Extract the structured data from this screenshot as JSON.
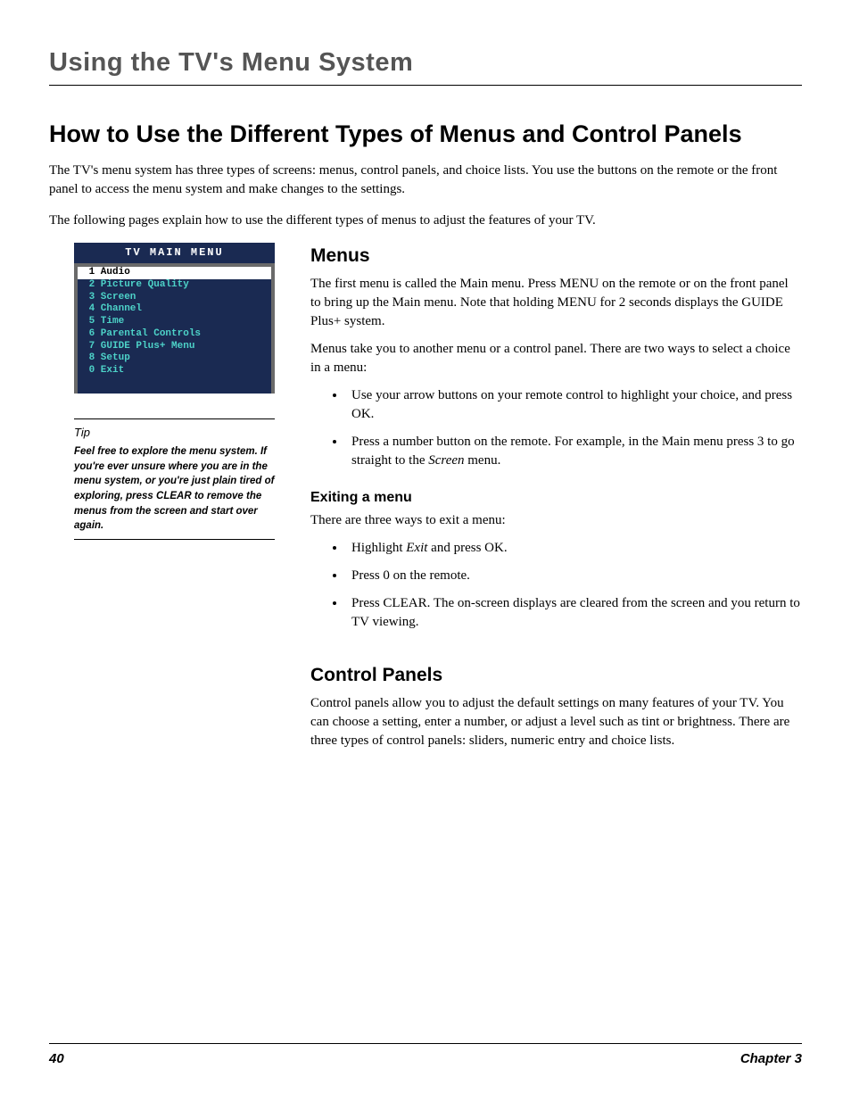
{
  "chapterTitle": "Using the TV's Menu System",
  "sectionTitle": "How to Use the Different Types of Menus and Control Panels",
  "intro": {
    "p1": "The TV's menu system has three types of screens: menus, control panels, and choice lists. You use the buttons on the remote or the front panel to access the menu system and make changes to the settings.",
    "p2": "The following pages explain how to use the different types of menus to adjust the features of your TV."
  },
  "tvMenu": {
    "title": "TV MAIN MENU",
    "items": [
      {
        "num": "1",
        "label": "Audio",
        "selected": true
      },
      {
        "num": "2",
        "label": "Picture Quality",
        "selected": false
      },
      {
        "num": "3",
        "label": "Screen",
        "selected": false
      },
      {
        "num": "4",
        "label": "Channel",
        "selected": false
      },
      {
        "num": "5",
        "label": "Time",
        "selected": false
      },
      {
        "num": "6",
        "label": "Parental Controls",
        "selected": false
      },
      {
        "num": "7",
        "label": "GUIDE Plus+ Menu",
        "selected": false
      },
      {
        "num": "8",
        "label": "Setup",
        "selected": false
      },
      {
        "num": "0",
        "label": "Exit",
        "selected": false
      }
    ]
  },
  "tip": {
    "label": "Tip",
    "text": "Feel free to explore the menu system. If you're ever unsure where you are in the menu system, or you're just plain tired of exploring, press CLEAR to remove the menus from the screen and start over again."
  },
  "menus": {
    "heading": "Menus",
    "p1": "The first menu is called the Main menu. Press MENU on the remote or on the front panel to bring up the Main menu. Note that holding MENU for 2 seconds displays the GUIDE Plus+ system.",
    "p2": "Menus take you to another menu or a control panel. There are two ways to select a choice in a menu:",
    "b1": "Use your arrow buttons on your remote control to highlight your choice, and press OK.",
    "b2a": "Press a number button on the remote. For example, in the Main menu press 3 to go straight to the ",
    "b2em": "Screen",
    "b2b": " menu."
  },
  "exiting": {
    "heading": "Exiting a menu",
    "p1": "There are three ways to exit a menu:",
    "b1a": "Highlight ",
    "b1em": "Exit",
    "b1b": " and press OK.",
    "b2": "Press 0 on the remote.",
    "b3": "Press CLEAR. The on-screen displays are cleared from the screen and you return to TV viewing."
  },
  "controlPanels": {
    "heading": "Control Panels",
    "p1": "Control panels allow you to adjust the default settings on many features of your TV. You can choose a setting, enter a number, or adjust a level such as tint or brightness. There are three types of control panels: sliders, numeric entry and choice lists."
  },
  "footer": {
    "page": "40",
    "chapter": "Chapter 3"
  }
}
